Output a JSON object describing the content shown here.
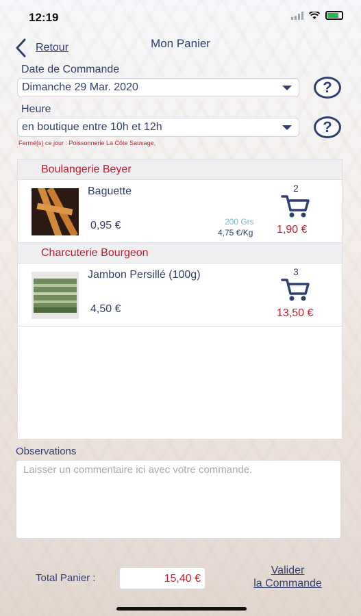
{
  "status": {
    "time": "12:19"
  },
  "nav": {
    "back_label": "Retour",
    "title": "Mon Panier"
  },
  "order": {
    "date_label": "Date de Commande",
    "date_value": "Dimanche 29 Mar. 2020",
    "time_label": "Heure",
    "time_value": "en boutique entre 10h et 12h",
    "help_symbol": "?",
    "warning": "Fermé(s) ce jour : Poissonnerie La Côte Sauvage,"
  },
  "shops": [
    {
      "name": "Boulangerie Beyer",
      "items": [
        {
          "name": "Baguette",
          "unit_price": "0,95 €",
          "weight": "200 Grs",
          "price_per_kg": "4,75 €/Kg",
          "quantity": "2",
          "total": "1,90 €"
        }
      ]
    },
    {
      "name": "Charcuterie Bourgeon",
      "items": [
        {
          "name": "Jambon Persillé (100g)",
          "unit_price": "4,50 €",
          "quantity": "3",
          "total": "13,50 €"
        }
      ]
    }
  ],
  "observations": {
    "label": "Observations",
    "placeholder": "Laisser un commentaire ici avec votre commande."
  },
  "footer": {
    "total_label": "Total Panier :",
    "total_value": "15,40 €",
    "validate_line1": "Valider",
    "validate_line2": "la Commande"
  },
  "colors": {
    "primary": "#2f3f72",
    "accent_red": "#c8182a",
    "weight_blue": "#7fb4e4"
  },
  "icons": [
    "chevron-left-icon",
    "help-icon",
    "caret-down-icon",
    "cart-icon",
    "wifi-icon",
    "battery-icon",
    "signal-icon"
  ]
}
